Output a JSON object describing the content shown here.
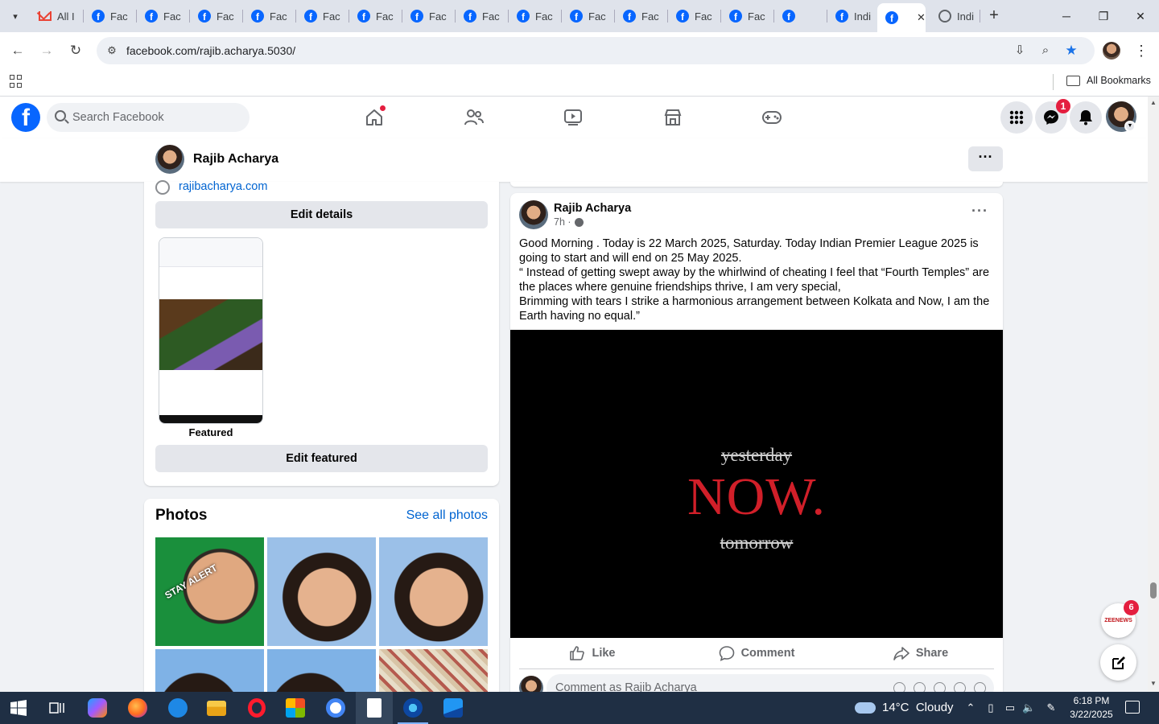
{
  "browser": {
    "tabs": [
      {
        "label": "All I",
        "icon": "gmail-icon"
      },
      {
        "label": "Fac",
        "icon": "facebook-icon"
      },
      {
        "label": "Fac",
        "icon": "facebook-icon"
      },
      {
        "label": "Fac",
        "icon": "facebook-icon"
      },
      {
        "label": "Fac",
        "icon": "facebook-icon"
      },
      {
        "label": "Fac",
        "icon": "facebook-icon"
      },
      {
        "label": "Fac",
        "icon": "facebook-icon"
      },
      {
        "label": "Fac",
        "icon": "facebook-icon"
      },
      {
        "label": "Fac",
        "icon": "facebook-icon"
      },
      {
        "label": "Fac",
        "icon": "facebook-icon"
      },
      {
        "label": "Fac",
        "icon": "facebook-icon"
      },
      {
        "label": "Fac",
        "icon": "facebook-icon"
      },
      {
        "label": "Fac",
        "icon": "facebook-icon"
      },
      {
        "label": "Fac",
        "icon": "facebook-icon"
      },
      {
        "label": "",
        "icon": "facebook-icon",
        "active": true
      },
      {
        "label": "Indi",
        "icon": "globe-icon"
      }
    ],
    "url": "facebook.com/rajib.acharya.5030/",
    "bookmarks_label": "All Bookmarks"
  },
  "facebook": {
    "search_placeholder": "Search Facebook",
    "messenger_badge": "1",
    "profile_name": "Rajib Acharya"
  },
  "intro": {
    "website": "rajibacharya.com",
    "edit_details": "Edit details",
    "featured_label": "Featured",
    "edit_featured": "Edit featured"
  },
  "photos": {
    "title": "Photos",
    "see_all": "See all photos",
    "caption_first": "STAY ALERT"
  },
  "post": {
    "author": "Rajib Acharya",
    "time": "7h ·",
    "paragraphs": [
      "Good Morning . Today is 22 March 2025, Saturday. Today Indian Premier League 2025 is going to start and will end on 25 May 2025.",
      "“ Instead of getting swept away by the whirlwind of cheating I feel that “Fourth Temples” are the places where genuine friendships thrive, I am very special,",
      "Brimming with tears I strike a harmonious arrangement between Kolkata and Now, I am the Earth having no equal.”"
    ],
    "image_words": {
      "top": "yesterday",
      "middle": "NOW.",
      "bottom": "tomorrow"
    },
    "actions": {
      "like": "Like",
      "comment": "Comment",
      "share": "Share"
    },
    "comment_placeholder": "Comment as Rajib Acharya"
  },
  "widgets": {
    "zee_label": "ZEENEWS",
    "zee_badge": "6"
  },
  "taskbar": {
    "weather": "14°C  Cloudy",
    "time": "6:18 PM",
    "date": "3/22/2025"
  }
}
